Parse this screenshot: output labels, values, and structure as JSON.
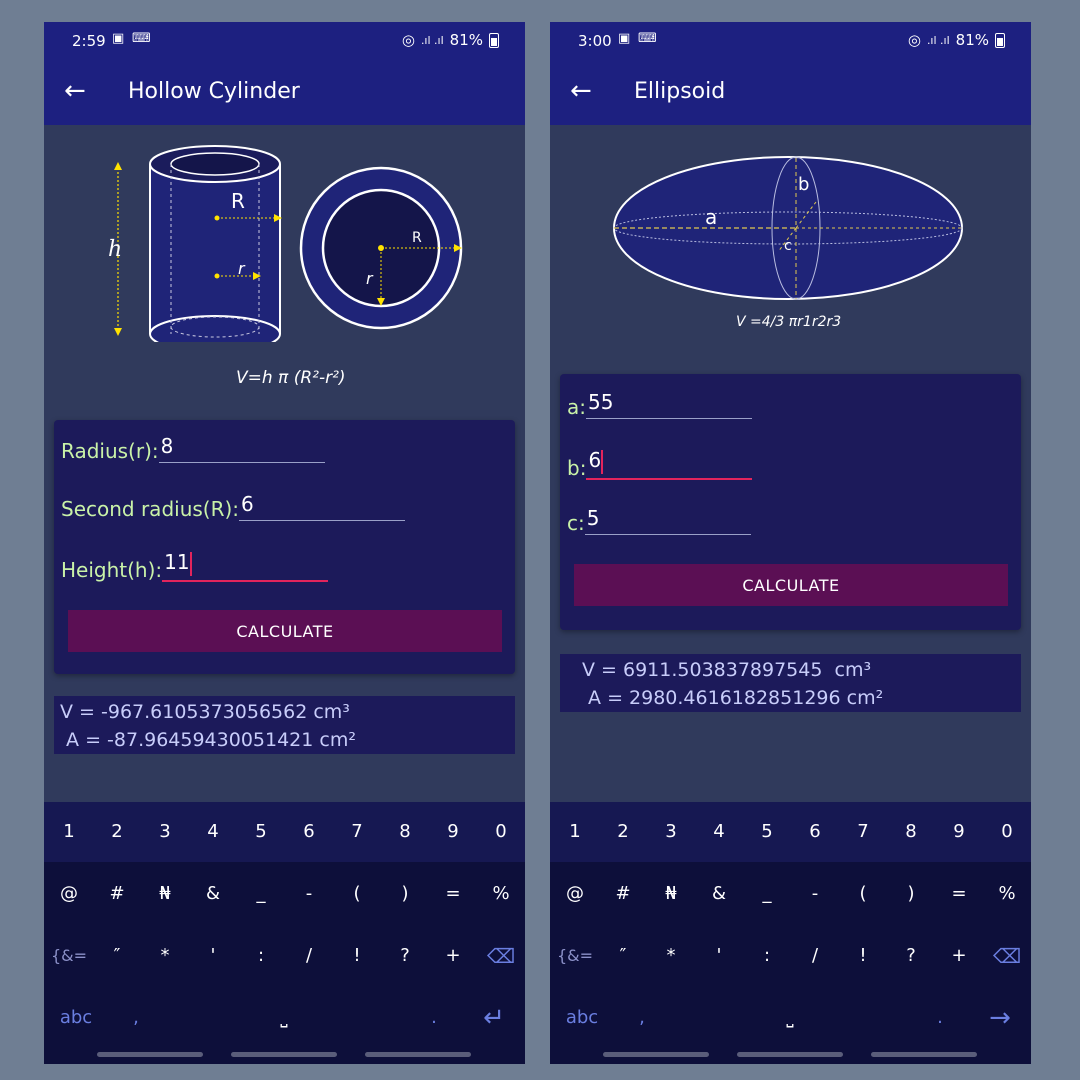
{
  "left": {
    "status": {
      "time": "2:59",
      "battery": "81%"
    },
    "title": "Hollow Cylinder",
    "diagram": {
      "label_R": "R",
      "label_r": "r",
      "label_h": "h",
      "label_R2": "R",
      "label_r2": "r"
    },
    "formula": "V=h π (R²-r²)",
    "fields": [
      {
        "label": "Radius(r):",
        "value": "8"
      },
      {
        "label": "Second radius(R):",
        "value": "6"
      },
      {
        "label": "Height(h):",
        "value": "11"
      }
    ],
    "calculate_label": "CALCULATE",
    "result_v": "V = -967.6105373056562 cm³",
    "result_a": " A = -87.96459430051421 cm²"
  },
  "right": {
    "status": {
      "time": "3:00",
      "battery": "81%"
    },
    "title": "Ellipsoid",
    "diagram": {
      "label_a": "a",
      "label_b": "b",
      "label_c": "c"
    },
    "formula": "V =4/3 πr1r2r3",
    "fields": [
      {
        "label": "a:",
        "value": "55"
      },
      {
        "label": "b:",
        "value": "6"
      },
      {
        "label": "c:",
        "value": "5"
      }
    ],
    "calculate_label": "CALCULATE",
    "result_v": "V = 6911.503837897545  cm³",
    "result_a": " A = 2980.4616182851296 cm²"
  },
  "keyboard": {
    "numbers": [
      "1",
      "2",
      "3",
      "4",
      "5",
      "6",
      "7",
      "8",
      "9",
      "0"
    ],
    "row2": [
      "@",
      "#",
      "₦",
      "&",
      "_",
      "-",
      "(",
      ")",
      "=",
      "%"
    ],
    "row3": [
      "{&=",
      "″",
      "*",
      "'",
      ":",
      "/",
      "!",
      "?",
      "+"
    ],
    "row4": {
      "abc": "abc",
      "comma": ",",
      "period": "."
    }
  },
  "icons": {
    "back": "arrow-left-icon",
    "backspace": "backspace-icon",
    "enter": "enter-icon",
    "next": "arrow-right-icon",
    "space": "space-icon",
    "wifi": "hotspot-icon",
    "signal": "signal-icon",
    "battery": "battery-icon",
    "gallery": "image-icon",
    "keyboard_status": "keyboard-icon"
  },
  "colors": {
    "appbar": "#1d2080",
    "body": "#303a5c",
    "card": "#1c1a5a",
    "label": "#c9f2a8",
    "button": "#5b0f54",
    "accent": "#e2245c",
    "result_text": "#c8cdfa"
  }
}
